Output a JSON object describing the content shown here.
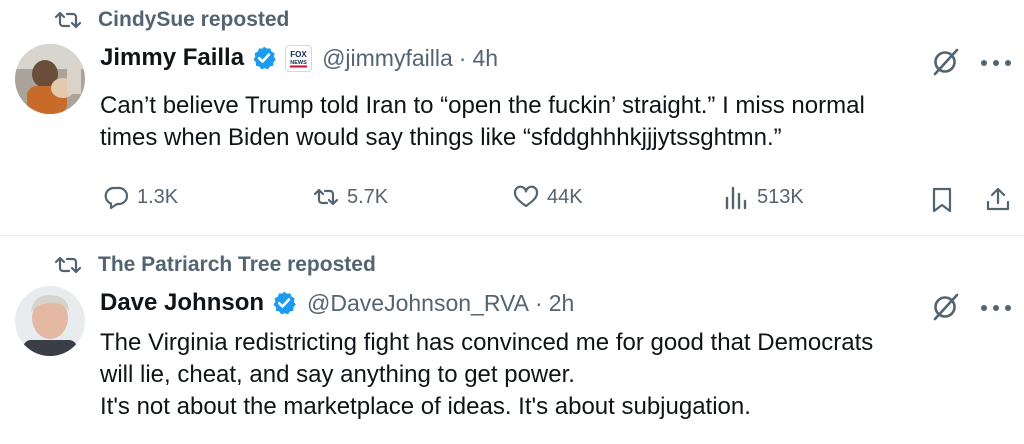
{
  "posts": [
    {
      "reposted_by": "CindySue reposted",
      "author": {
        "name": "Jimmy Failla",
        "handle": "@jimmyfailla",
        "time": "4h",
        "affiliation_badge": "FOX NEWS"
      },
      "text_lines": [
        "Can’t believe Trump told Iran to “open the fuckin’ straight.” I miss  normal",
        "times when Biden would say things like “sfddghhhkjjjytssghtmn.”"
      ],
      "stats": {
        "replies": "1.3K",
        "reposts": "5.7K",
        "likes": "44K",
        "views": "513K"
      }
    },
    {
      "reposted_by": "The Patriarch Tree reposted",
      "author": {
        "name": "Dave Johnson",
        "handle": "@DaveJohnson_RVA",
        "time": "2h"
      },
      "text_lines": [
        "The Virginia redistricting fight has convinced me for good that Democrats",
        "will lie, cheat, and say anything to get power.",
        "It's not about the marketplace of ideas.  It's about subjugation."
      ]
    }
  ],
  "separator": "·",
  "icons": {
    "repost": "repost-icon",
    "verified": "verified-badge-icon",
    "grok": "grok-icon",
    "more": "more-icon",
    "reply": "reply-icon",
    "like": "heart-icon",
    "views": "views-icon",
    "bookmark": "bookmark-icon",
    "share": "share-icon"
  },
  "colors": {
    "text": "#0f1419",
    "secondary": "#536471",
    "verified": "#1d9bf0",
    "divider": "#e6e9ec"
  }
}
